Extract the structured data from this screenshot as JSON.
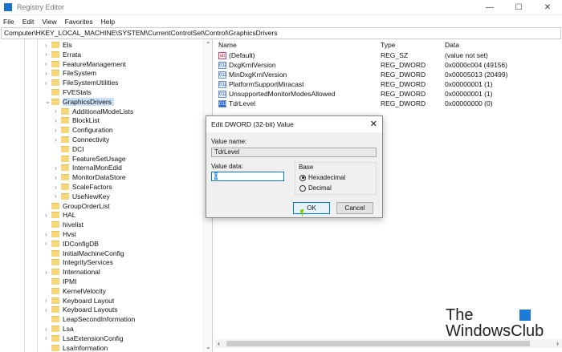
{
  "window": {
    "title": "Registry Editor",
    "controls": [
      "—",
      "☐",
      "✕"
    ]
  },
  "menu": [
    "File",
    "Edit",
    "View",
    "Favorites",
    "Help"
  ],
  "address": "Computer\\HKEY_LOCAL_MACHINE\\SYSTEM\\CurrentControlSet\\Control\\GraphicsDrivers",
  "tree": [
    {
      "label": "Els",
      "level": 0,
      "exp": true
    },
    {
      "label": "Errata",
      "level": 0,
      "exp": true
    },
    {
      "label": "FeatureManagement",
      "level": 0,
      "exp": true
    },
    {
      "label": "FileSystem",
      "level": 0,
      "exp": true
    },
    {
      "label": "FileSystemUtilities",
      "level": 0,
      "exp": true
    },
    {
      "label": "FVEStats",
      "level": 0,
      "exp": false
    },
    {
      "label": "GraphicsDrivers",
      "level": 0,
      "exp": true,
      "open": true,
      "selected": true
    },
    {
      "label": "AdditionalModeLists",
      "level": 1,
      "exp": true
    },
    {
      "label": "BlockList",
      "level": 1,
      "exp": true
    },
    {
      "label": "Configuration",
      "level": 1,
      "exp": true
    },
    {
      "label": "Connectivity",
      "level": 1,
      "exp": true
    },
    {
      "label": "DCI",
      "level": 1,
      "exp": false
    },
    {
      "label": "FeatureSetUsage",
      "level": 1,
      "exp": false
    },
    {
      "label": "InternalMonEdid",
      "level": 1,
      "exp": true
    },
    {
      "label": "MonitorDataStore",
      "level": 1,
      "exp": true
    },
    {
      "label": "ScaleFactors",
      "level": 1,
      "exp": true
    },
    {
      "label": "UseNewKey",
      "level": 1,
      "exp": true
    },
    {
      "label": "GroupOrderList",
      "level": 0,
      "exp": false
    },
    {
      "label": "HAL",
      "level": 0,
      "exp": true
    },
    {
      "label": "hivelist",
      "level": 0,
      "exp": false
    },
    {
      "label": "Hvsi",
      "level": 0,
      "exp": true
    },
    {
      "label": "IDConfigDB",
      "level": 0,
      "exp": true
    },
    {
      "label": "InitialMachineConfig",
      "level": 0,
      "exp": false
    },
    {
      "label": "IntegrityServices",
      "level": 0,
      "exp": false
    },
    {
      "label": "International",
      "level": 0,
      "exp": true
    },
    {
      "label": "IPMI",
      "level": 0,
      "exp": false
    },
    {
      "label": "KernelVelocity",
      "level": 0,
      "exp": false
    },
    {
      "label": "Keyboard Layout",
      "level": 0,
      "exp": true
    },
    {
      "label": "Keyboard Layouts",
      "level": 0,
      "exp": true
    },
    {
      "label": "LeapSecondInformation",
      "level": 0,
      "exp": false
    },
    {
      "label": "Lsa",
      "level": 0,
      "exp": true
    },
    {
      "label": "LsaExtensionConfig",
      "level": 0,
      "exp": true
    },
    {
      "label": "LsaInformation",
      "level": 0,
      "exp": false
    }
  ],
  "columns": {
    "name": "Name",
    "type": "Type",
    "data": "Data"
  },
  "values": [
    {
      "name": "(Default)",
      "type": "REG_SZ",
      "data": "(value not set)",
      "icon": "ab"
    },
    {
      "name": "DxgKrnlVersion",
      "type": "REG_DWORD",
      "data": "0x0000c004 (49156)",
      "icon": "011"
    },
    {
      "name": "MinDxgKrnlVersion",
      "type": "REG_DWORD",
      "data": "0x00005013 (20499)",
      "icon": "011"
    },
    {
      "name": "PlatformSupportMiracast",
      "type": "REG_DWORD",
      "data": "0x00000001 (1)",
      "icon": "011"
    },
    {
      "name": "UnsupportedMonitorModesAllowed",
      "type": "REG_DWORD",
      "data": "0x00000001 (1)",
      "icon": "011"
    },
    {
      "name": "TdrLevel",
      "type": "REG_DWORD",
      "data": "0x00000000 (0)",
      "icon": "011"
    }
  ],
  "dialog": {
    "title": "Edit DWORD (32-bit) Value",
    "close": "✕",
    "value_name_label": "Value name:",
    "value_name": "TdrLevel",
    "value_data_label": "Value data:",
    "value_data": "0",
    "base_label": "Base",
    "hex": "Hexadecimal",
    "dec": "Decimal",
    "ok": "OK",
    "cancel": "Cancel"
  },
  "watermark": {
    "line1": "The",
    "line2": "WindowsClub"
  }
}
